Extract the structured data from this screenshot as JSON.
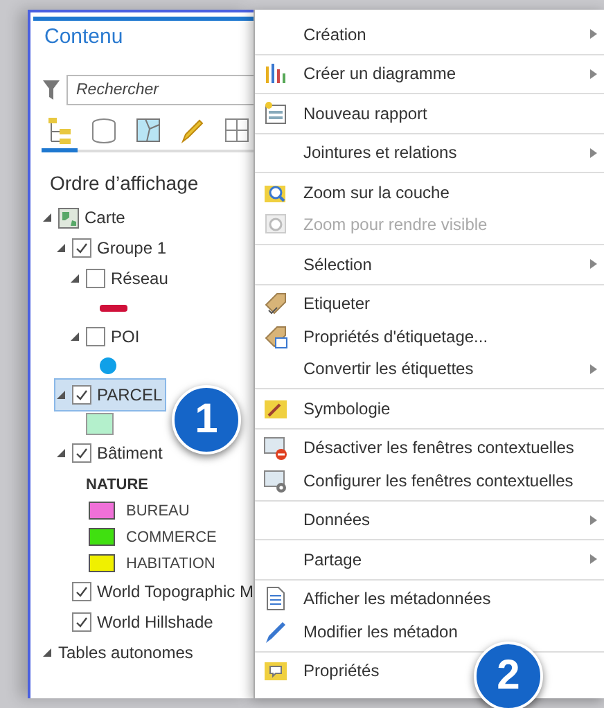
{
  "panel": {
    "title": "Contenu",
    "search": {
      "placeholder": "Rechercher"
    },
    "tabs": [
      {
        "kind": "tree",
        "selected": true
      },
      {
        "kind": "database",
        "selected": false
      },
      {
        "kind": "map",
        "selected": false
      },
      {
        "kind": "pencil",
        "selected": false
      },
      {
        "kind": "grid",
        "selected": false
      }
    ],
    "heading": "Ordre d’affichage",
    "tree": [
      {
        "label": "Carte",
        "kind": "map",
        "expanded": true,
        "selected": false,
        "children": [
          {
            "label": "Groupe 1",
            "checked": true,
            "expanded": true,
            "selected": false,
            "children": [
              {
                "label": "Réseau",
                "checked": false,
                "expanded": true,
                "selected": false,
                "symbol": {
                  "kind": "line",
                  "color": "#d0103a"
                }
              },
              {
                "label": "POI",
                "checked": false,
                "expanded": true,
                "selected": false,
                "symbol": {
                  "kind": "dot",
                  "color": "#10a0e8"
                }
              }
            ]
          },
          {
            "label": "PARCEL",
            "checked": true,
            "expanded": true,
            "selected": true,
            "symbol": {
              "kind": "square",
              "color": "#b4f0cc"
            }
          },
          {
            "label": "Bâtiment",
            "checked": true,
            "expanded": true,
            "selected": false,
            "legend": {
              "heading": "NATURE",
              "items": [
                {
                  "label": "BUREAU",
                  "color": "#f070d8"
                },
                {
                  "label": "COMMERCE",
                  "color": "#40e010"
                },
                {
                  "label": "HABITATION",
                  "color": "#f0f000"
                }
              ]
            }
          },
          {
            "label": "World Topographic M",
            "checked": true,
            "selected": false
          },
          {
            "label": "World Hillshade",
            "checked": true,
            "selected": false
          }
        ]
      },
      {
        "label": "Tables autonomes",
        "expanded": true,
        "selected": false
      }
    ]
  },
  "menu": {
    "groups": [
      [
        {
          "label": "Création",
          "kind": "none",
          "submenu": true,
          "disabled": false
        }
      ],
      [
        {
          "label": "Créer un diagramme",
          "kind": "chart",
          "submenu": true,
          "disabled": false
        }
      ],
      [
        {
          "label": "Nouveau rapport",
          "kind": "report",
          "submenu": false,
          "disabled": false
        }
      ],
      [
        {
          "label": "Jointures et relations",
          "kind": "none",
          "submenu": true,
          "disabled": false
        }
      ],
      [
        {
          "label": "Zoom sur la couche",
          "kind": "zoom",
          "submenu": false,
          "disabled": false
        },
        {
          "label": "Zoom pour rendre visible",
          "kind": "zoomscale",
          "submenu": false,
          "disabled": true
        }
      ],
      [
        {
          "label": "Sélection",
          "kind": "none",
          "submenu": true,
          "disabled": false
        }
      ],
      [
        {
          "label": "Etiqueter",
          "kind": "label",
          "submenu": false,
          "disabled": false
        },
        {
          "label": "Propriétés d'étiquetage...",
          "kind": "labelprops",
          "submenu": false,
          "disabled": false
        },
        {
          "label": "Convertir les étiquettes",
          "kind": "none",
          "submenu": true,
          "disabled": false
        }
      ],
      [
        {
          "label": "Symbologie",
          "kind": "symbology",
          "submenu": false,
          "disabled": false
        }
      ],
      [
        {
          "label": "Désactiver les fenêtres contextuelles",
          "kind": "popupoff",
          "submenu": false,
          "disabled": false
        },
        {
          "label": "Configurer les fenêtres contextuelles",
          "kind": "popupcfg",
          "submenu": false,
          "disabled": false
        }
      ],
      [
        {
          "label": "Données",
          "kind": "none",
          "submenu": true,
          "disabled": false
        }
      ],
      [
        {
          "label": "Partage",
          "kind": "none",
          "submenu": true,
          "disabled": false
        }
      ],
      [
        {
          "label": "Afficher les métadonnées",
          "kind": "document",
          "submenu": false,
          "disabled": false
        },
        {
          "label": "Modifier les métadon",
          "kind": "pencil",
          "submenu": false,
          "disabled": false
        }
      ],
      [
        {
          "label": "Propriétés",
          "kind": "properties",
          "submenu": false,
          "disabled": false
        }
      ]
    ]
  },
  "callouts": [
    "1",
    "2"
  ]
}
